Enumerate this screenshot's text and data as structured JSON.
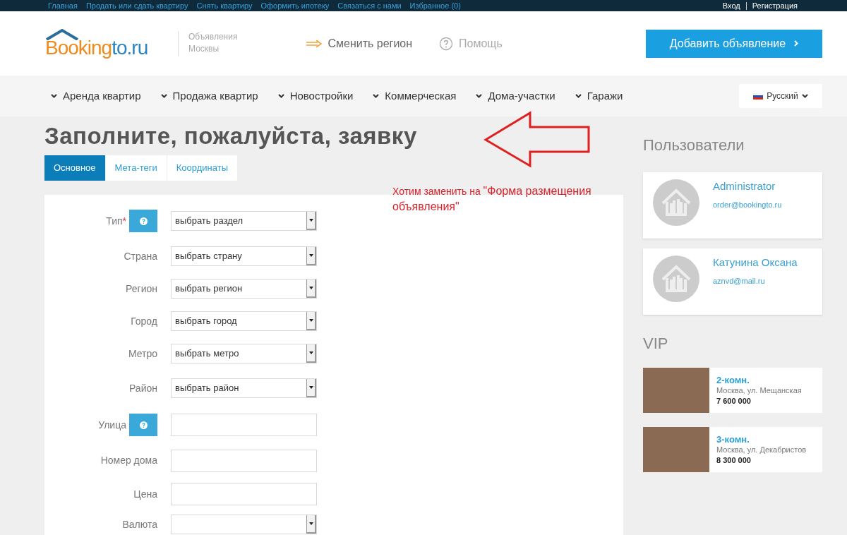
{
  "top_links": [
    {
      "label": "Главная"
    },
    {
      "label": "Продать или сдать квартиру"
    },
    {
      "label": "Снять квартиру"
    },
    {
      "label": "Оформить ипотеку"
    },
    {
      "label": "Связаться с нами"
    },
    {
      "label": "Избранное (0)"
    }
  ],
  "auth_links": [
    {
      "label": "Вход"
    },
    {
      "label": "Регистрация"
    }
  ],
  "logo": {
    "part_1": "Booking",
    "part_2": "to.ru"
  },
  "tagline": {
    "line_1": "Объявления",
    "line_2": "Москвы"
  },
  "change_region": "Сменить регион",
  "help": "Помощь",
  "add_button": "Добавить объявление",
  "nav": [
    {
      "label": "Аренда квартир"
    },
    {
      "label": "Продажа квартир"
    },
    {
      "label": "Новостройки"
    },
    {
      "label": "Коммерческая"
    },
    {
      "label": "Дома-участки"
    },
    {
      "label": "Гаражи"
    }
  ],
  "language": "Русский",
  "page_title": "Заполните, пожалуйста, заявку",
  "annotation": {
    "lead": "Хотим заменить на",
    "quote": "\"Форма размещения объявления\""
  },
  "tabs": [
    {
      "label": "Основное",
      "selected": true
    },
    {
      "label": "Мета-теги",
      "selected": false
    },
    {
      "label": "Координаты",
      "selected": false
    }
  ],
  "form": [
    {
      "kind": "select",
      "label": "Тип",
      "required": true,
      "help": true,
      "value": "выбрать раздел"
    },
    {
      "kind": "select",
      "label": "Страна",
      "required": false,
      "help": false,
      "value": "выбрать страну"
    },
    {
      "kind": "select",
      "label": "Регион",
      "required": false,
      "help": false,
      "value": "выбрать регион"
    },
    {
      "kind": "select",
      "label": "Город",
      "required": false,
      "help": false,
      "value": "выбрать город"
    },
    {
      "kind": "select",
      "label": "Метро",
      "required": false,
      "help": false,
      "value": "выбрать метро"
    },
    {
      "kind": "select",
      "label": "Район",
      "required": false,
      "help": false,
      "value": "выбрать район"
    },
    {
      "kind": "text",
      "label": "Улица",
      "required": false,
      "help": true
    },
    {
      "kind": "text",
      "label": "Номер дома",
      "required": false,
      "help": false
    },
    {
      "kind": "text",
      "label": "Цена",
      "required": false,
      "help": false
    },
    {
      "kind": "select",
      "label": "Валюта",
      "required": false,
      "help": false
    }
  ],
  "users_title": "Пользователи",
  "users": [
    {
      "name": "Administrator",
      "email": "order@bookingto.ru"
    },
    {
      "name": "Катунина Оксана",
      "email": "aznvd@mail.ru"
    }
  ],
  "vip_title": "VIP",
  "vip": [
    {
      "title": "2-комн.",
      "address": "Москва, ул. Мещанская",
      "price": "7 600 000"
    },
    {
      "title": "3-комн.",
      "address": "Москва, ул. Декабристов",
      "price": "8 300 000"
    }
  ],
  "required_marker": "*"
}
